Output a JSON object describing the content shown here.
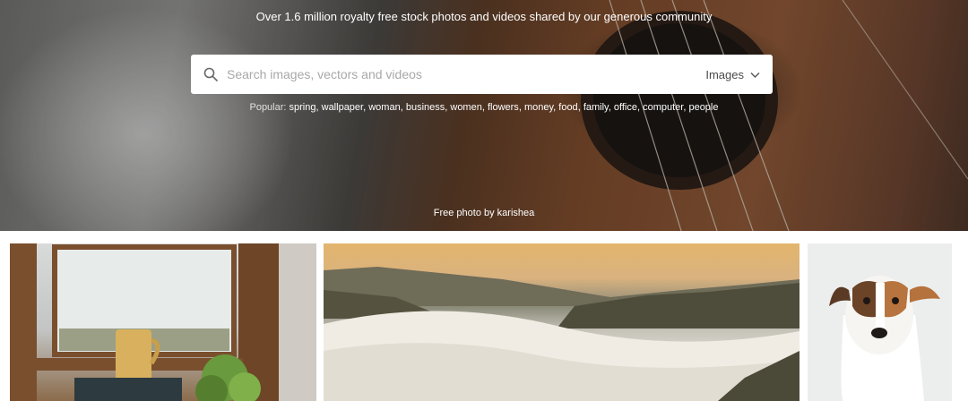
{
  "hero": {
    "tagline": "Over 1.6 million royalty free stock photos and videos shared by our generous community",
    "search": {
      "placeholder": "Search images, vectors and videos",
      "type_selected": "Images"
    },
    "popular": {
      "lead": "Popular:",
      "tags": [
        "spring",
        "wallpaper",
        "woman",
        "business",
        "women",
        "flowers",
        "money",
        "food",
        "family",
        "office",
        "computer",
        "people"
      ]
    },
    "credit": "Free photo by karishea"
  },
  "grid": {
    "tiles": [
      {
        "name": "window-coffee-photo"
      },
      {
        "name": "misty-mountains-photo"
      },
      {
        "name": "dog-photo"
      }
    ]
  },
  "colors": {
    "text_on_hero": "#ffffff",
    "placeholder": "#a8a8a8"
  }
}
